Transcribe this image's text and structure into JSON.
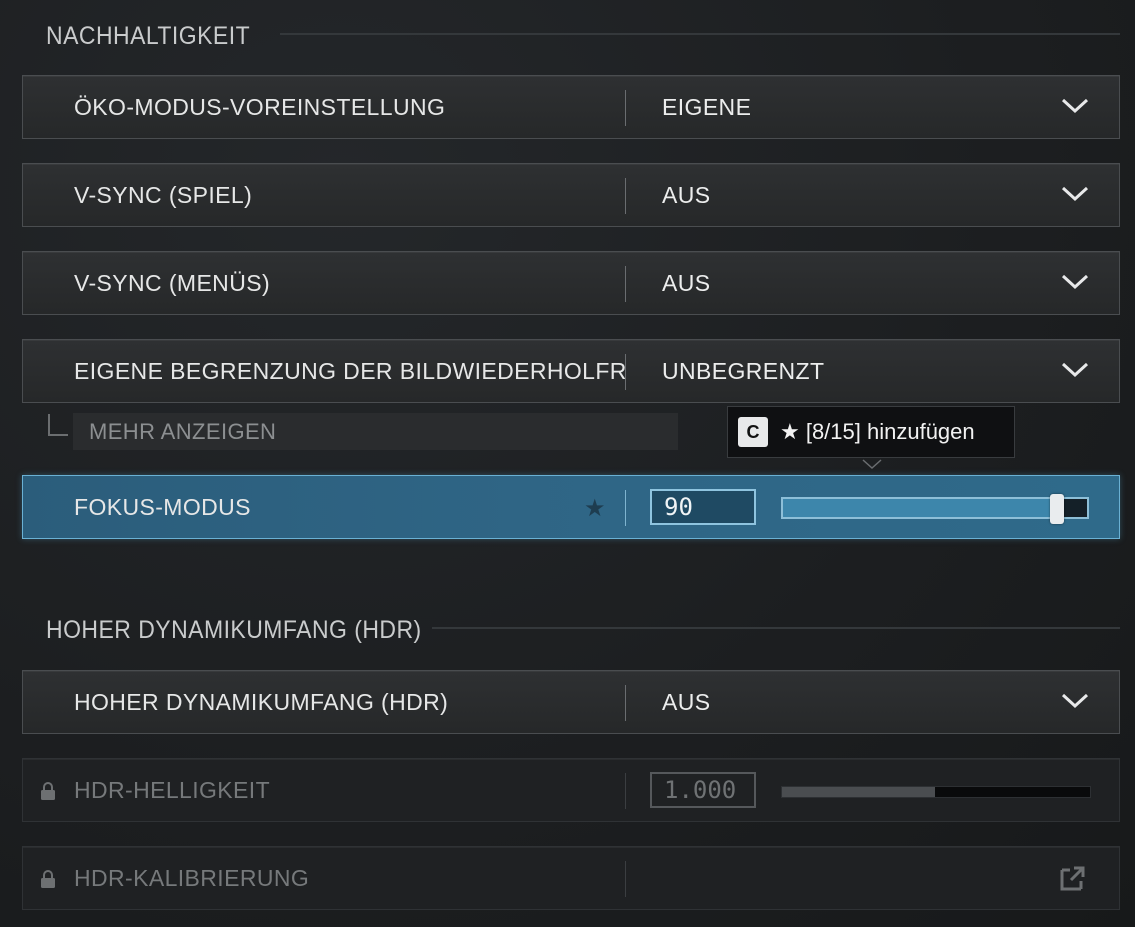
{
  "sections": {
    "sustainability": "NACHHALTIGKEIT",
    "hdr": "HOHER DYNAMIKUMFANG (HDR)"
  },
  "settings": [
    {
      "label": "ÖKO-MODUS-VOREINSTELLUNG",
      "value": "EIGENE",
      "type": "dropdown"
    },
    {
      "label": "V-SYNC (SPIEL)",
      "value": "AUS",
      "type": "dropdown"
    },
    {
      "label": "V-SYNC (MENÜS)",
      "value": "AUS",
      "type": "dropdown"
    },
    {
      "label": "EIGENE BEGRENZUNG DER BILDWIEDERHOLFR",
      "value": "UNBEGRENZT",
      "type": "dropdown"
    }
  ],
  "more": {
    "label": "MEHR ANZEIGEN"
  },
  "focus_mode": {
    "label": "FOKUS-MODUS",
    "value": "90",
    "slider_fraction": 0.9,
    "favorite_icon": "star-icon"
  },
  "tooltip": {
    "key": "C",
    "text": "★ [8/15] hinzufügen"
  },
  "hdr_settings": [
    {
      "label": "HOHER DYNAMIKUMFANG (HDR)",
      "value": "AUS",
      "type": "dropdown"
    },
    {
      "label": "HDR-HELLIGKEIT",
      "value": "1.000",
      "type": "slider",
      "locked": true,
      "slider_fraction": 0.5
    },
    {
      "label": "HDR-KALIBRIERUNG",
      "type": "external",
      "locked": true
    }
  ],
  "colors": {
    "accent": "#2f6585",
    "accent_border": "#6ab1d4",
    "background": "#1b1d1e"
  }
}
